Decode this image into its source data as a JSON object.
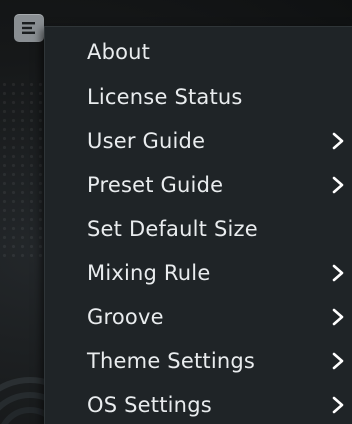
{
  "menu_button": {
    "icon": "menu-icon"
  },
  "menu": {
    "items": [
      {
        "label": "About",
        "has_submenu": false
      },
      {
        "label": "License Status",
        "has_submenu": false
      },
      {
        "label": "User Guide",
        "has_submenu": true
      },
      {
        "label": "Preset Guide",
        "has_submenu": true
      },
      {
        "label": "Set Default Size",
        "has_submenu": false
      },
      {
        "label": "Mixing Rule",
        "has_submenu": true
      },
      {
        "label": "Groove",
        "has_submenu": true
      },
      {
        "label": "Theme Settings",
        "has_submenu": true
      },
      {
        "label": "OS Settings",
        "has_submenu": true
      }
    ]
  },
  "colors": {
    "menu_background": "#1f2427",
    "menu_text": "#e9ecee",
    "button_background": "#8a8f93"
  }
}
